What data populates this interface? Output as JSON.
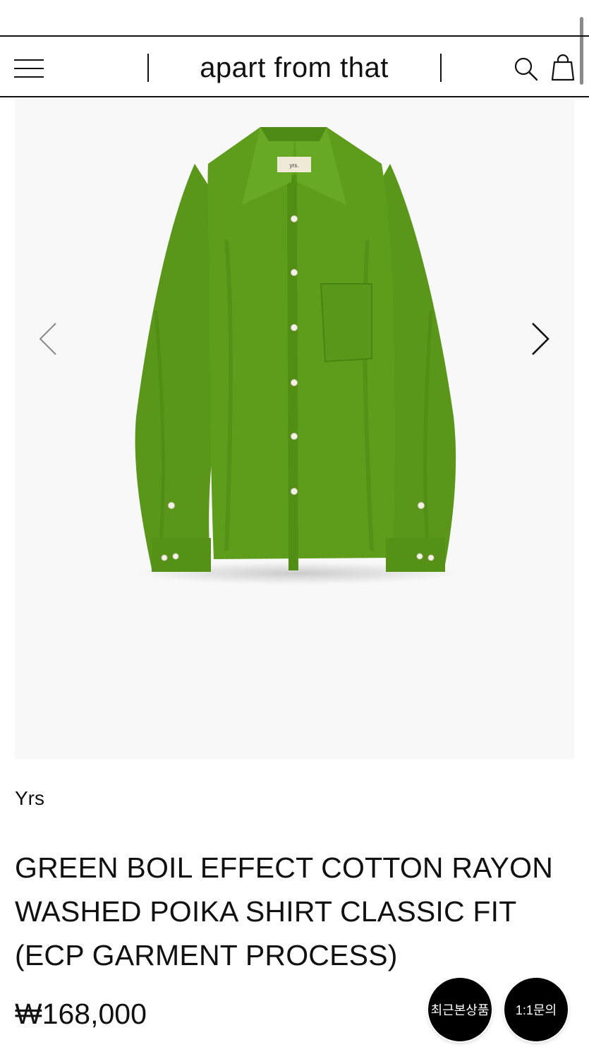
{
  "header": {
    "logo_text": "apart from that"
  },
  "icons": {
    "menu": "hamburger-menu-icon",
    "search": "search-icon",
    "cart": "shopping-bag-icon",
    "prev": "chevron-left-icon",
    "next": "chevron-right-icon"
  },
  "product": {
    "brand": "Yrs",
    "title_lines": [
      "GREEN BOIL EFFECT COTTON RAYON",
      "WASHED POIKA SHIRT CLASSIC FIT",
      "(ECP GARMENT PROCESS)"
    ],
    "price": "₩168,000",
    "label_text": "yrs.",
    "color": "#5e9c1c"
  },
  "floating_buttons": {
    "recent": "최근본상품",
    "inquiry": "1:1문의"
  },
  "colors": {
    "text": "#111111",
    "image_bg": "#f8f8f8",
    "floating_bg": "#000000"
  }
}
